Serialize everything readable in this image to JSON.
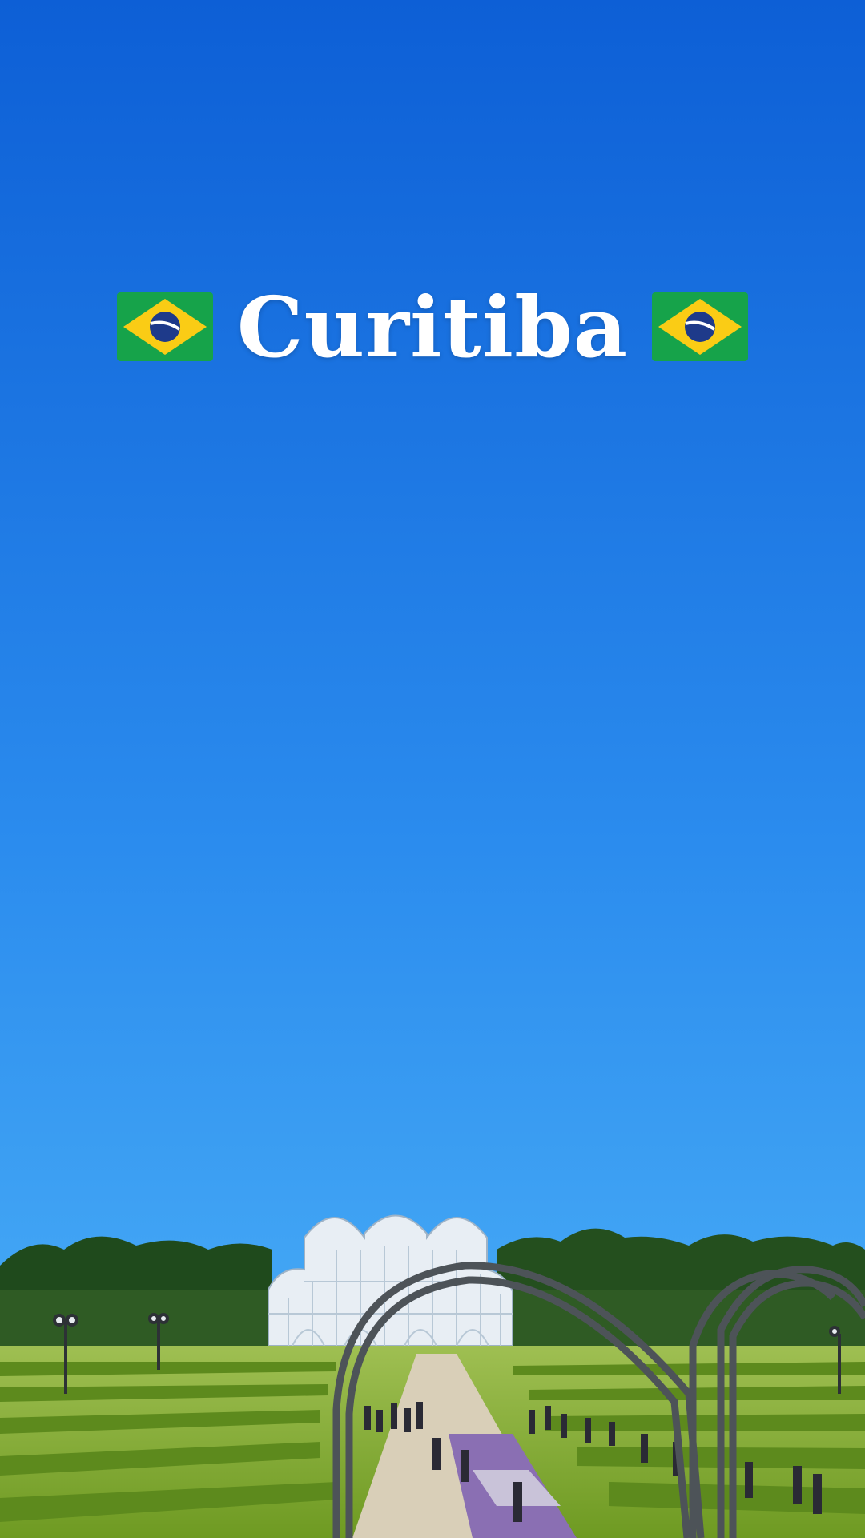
{
  "caption": {
    "title": "Curitiba",
    "flag_left_icon": "brazil-flag-icon",
    "flag_right_icon": "brazil-flag-icon"
  },
  "colors": {
    "sky_top": "#0d5fd6",
    "sky_bottom": "#4fb4f8",
    "hedge": "#7ea82c",
    "greenhouse": "#e8eef4"
  }
}
